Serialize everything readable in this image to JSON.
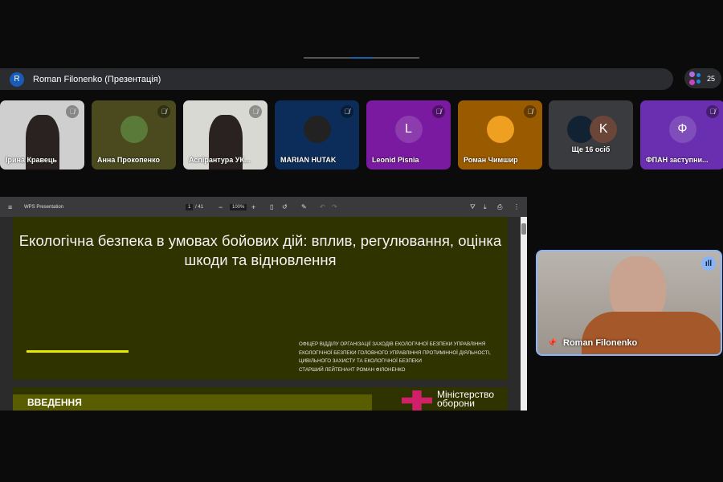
{
  "presenter_bar": {
    "avatar": "R",
    "title": "Roman Filonenko (Презентація)"
  },
  "participants_count": "25",
  "tiles": [
    {
      "name": "Ірина Кравець",
      "bg": "#cfcfcf"
    },
    {
      "name": "Анна Прокопенко",
      "bg": "#4a4a1e"
    },
    {
      "name": "Аспірантура УК...",
      "bg": "#d9d9d4"
    },
    {
      "name": "MARIAN HUTAK",
      "bg": "#0c2d5a"
    },
    {
      "name": "Leonid Pisnia",
      "initial": "L",
      "bg": "#7a1aa0"
    },
    {
      "name": "Роман Чимшир",
      "bg": "#9a5a00"
    },
    {
      "name": "Ще 16 осіб",
      "initial": "K",
      "bg": "#3a3b3e"
    },
    {
      "name": "ФПАН заступни...",
      "initial": "Ф",
      "bg": "#6a2fb0"
    }
  ],
  "viewer": {
    "app": "WPS Presentation",
    "page": "1",
    "pages": "/ 41",
    "zoom": "100%",
    "slide_title": "Екологічна безпека в умовах бойових дій: вплив, регулювання, оцінка шкоди та відновлення",
    "slide_sub1": "ОФІЦЕР ВІДДІЛУ ОРГАНІЗАЦІЇ ЗАХОДІВ ЕКОЛОГІЧНОЇ БЕЗПЕКИ УПРАВЛІННЯ ЕКОЛОГІЧНОЇ БЕЗПЕКИ ГОЛОВНОГО УПРАВЛІННЯ ПРОТИМІННОЇ ДІЯЛЬНОСТІ, ЦИВІЛЬНОГО ЗАХИСТУ ТА ЕКОЛОГІЧНОЇ БЕЗПЕКИ",
    "slide_sub2": "СТАРШИЙ ЛЕЙТЕНАНТ РОМАН ФІЛОНЕНКО",
    "slide2_heading": "ВВЕДЕННЯ",
    "ministry": "Міністерство оборони"
  },
  "self_view": {
    "name": "Roman Filonenko"
  }
}
